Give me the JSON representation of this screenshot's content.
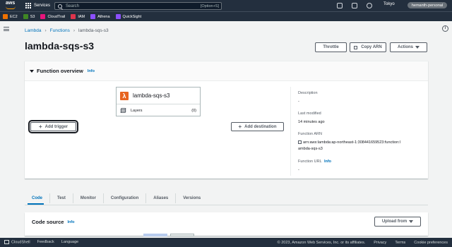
{
  "topnav": {
    "logo_text": "aws",
    "services_label": "Services",
    "search_placeholder": "Search",
    "search_shortcut": "[Option+S]",
    "region": "Tokyo",
    "account": "hemanth-personal"
  },
  "favorites": [
    {
      "label": "EC2",
      "color": "#ed7100"
    },
    {
      "label": "S3",
      "color": "#3f8624"
    },
    {
      "label": "CloudTrail",
      "color": "#e7157b"
    },
    {
      "label": "IAM",
      "color": "#dd344c"
    },
    {
      "label": "Athena",
      "color": "#8c4fff"
    },
    {
      "label": "QuickSight",
      "color": "#8c4fff"
    }
  ],
  "breadcrumb": {
    "root": "Lambda",
    "section": "Functions",
    "current": "lambda-sqs-s3"
  },
  "page": {
    "title": "lambda-sqs-s3"
  },
  "header_actions": {
    "throttle": "Throttle",
    "copy_arn": "Copy ARN",
    "actions": "Actions"
  },
  "overview": {
    "title": "Function overview",
    "info": "Info",
    "function_name": "lambda-sqs-s3",
    "layers_label": "Layers",
    "layers_count": "(0)",
    "add_trigger": "Add trigger",
    "add_destination": "Add destination",
    "description_label": "Description",
    "description_value": "-",
    "last_modified_label": "Last modified",
    "last_modified_value": "14 minutes ago",
    "arn_label": "Function ARN",
    "arn_value_line1": "arn:aws:lambda:ap-northeast-1:308441659523:function:l",
    "arn_value_line2": "ambda-sqs-s3",
    "url_label": "Function URL",
    "url_info": "Info",
    "url_value": "-"
  },
  "tabs": [
    "Code",
    "Test",
    "Monitor",
    "Configuration",
    "Aliases",
    "Versions"
  ],
  "active_tab": "Code",
  "code_source": {
    "title": "Code source",
    "info": "Info",
    "upload_from": "Upload from"
  },
  "footer": {
    "cloudshell": "CloudShell",
    "feedback": "Feedback",
    "language": "Language",
    "copyright": "© 2023, Amazon Web Services, Inc. or its affiliates.",
    "privacy": "Privacy",
    "terms": "Terms",
    "cookie": "Cookie preferences"
  },
  "colors": {
    "nav_bg": "#232f3e",
    "link": "#0073bb",
    "lambda_orange": "#e7641f"
  }
}
